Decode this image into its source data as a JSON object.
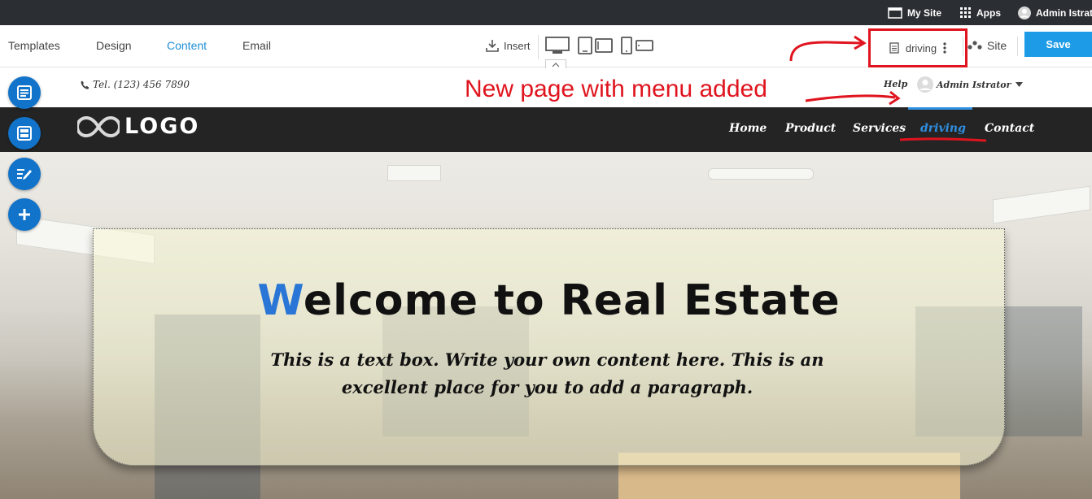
{
  "topbar": {
    "my_site": "My Site",
    "apps": "Apps",
    "admin": "Admin Istrato"
  },
  "toolbar": {
    "tabs": [
      {
        "label": "Templates"
      },
      {
        "label": "Design"
      },
      {
        "label": "Content",
        "active": true
      },
      {
        "label": "Email"
      }
    ],
    "insert_label": "Insert",
    "current_page": "driving",
    "site_label": "Site",
    "save_label": "Save",
    "devices": [
      "desktop-icon",
      "tablet-portrait-icon",
      "tablet-landscape-icon",
      "phone-portrait-icon",
      "phone-landscape-icon"
    ]
  },
  "site_header": {
    "phone": "Tel. (123) 456 7890",
    "help": "Help",
    "admin": "Admin Istrator"
  },
  "annotation": {
    "text": "New page with menu added",
    "color": "#e0141e"
  },
  "nav": {
    "logo": "LOGO",
    "items": [
      {
        "label": "Home"
      },
      {
        "label": "Product"
      },
      {
        "label": "Services"
      },
      {
        "label": "driving",
        "active": true
      },
      {
        "label": "Contact"
      }
    ]
  },
  "hero": {
    "title_first": "W",
    "title_rest": "elcome to Real Estate",
    "paragraph": "This is a text box. Write your own content here. This is an excellent place for you to add a paragraph."
  },
  "left_tools": [
    "sections-icon",
    "layout-icon",
    "edit-text-icon",
    "add-icon"
  ],
  "colors": {
    "accent": "#1e9be6",
    "nav_active": "#2f8fe0",
    "topbar_bg": "#2b2f33",
    "nav_bg": "#242424",
    "fab_bg": "#1173c9"
  }
}
